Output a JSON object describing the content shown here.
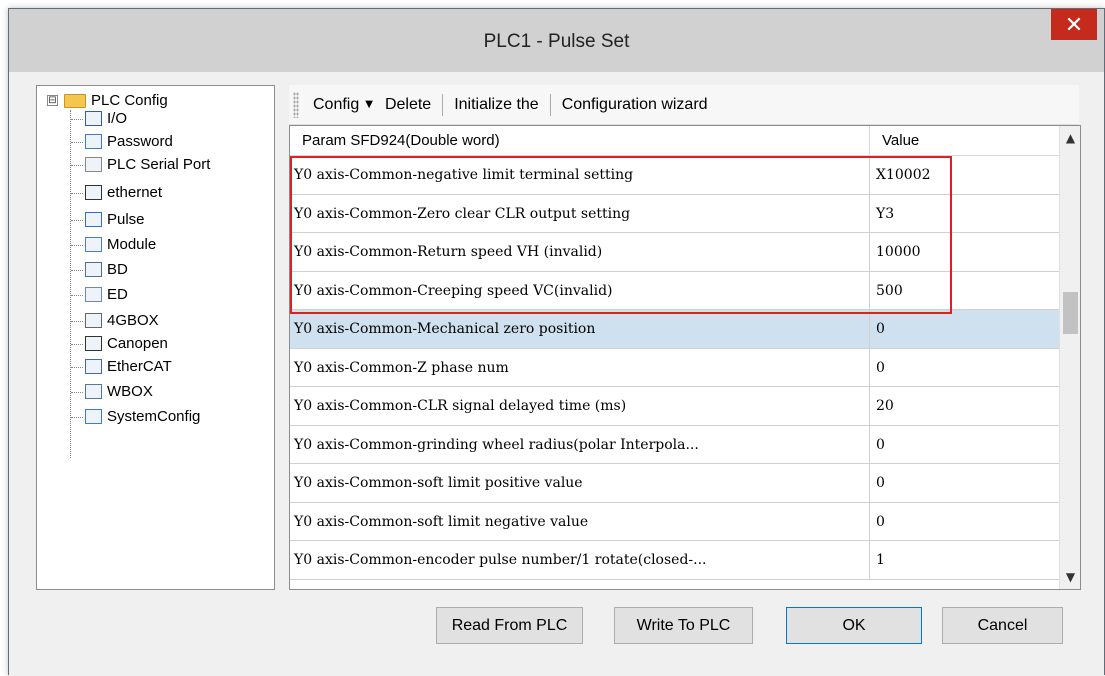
{
  "window": {
    "title": "PLC1 - Pulse  Set",
    "close_glyph": "✕"
  },
  "tree": {
    "root": {
      "label": "PLC Config",
      "expander": "⊟",
      "icon": "folder-icon"
    },
    "items": [
      {
        "label": "I/O",
        "icon": "io-icon"
      },
      {
        "label": "Password",
        "icon": "password-icon"
      },
      {
        "label": "PLC Serial Port",
        "icon": "serial-port-icon"
      },
      {
        "label": "ethernet",
        "icon": "ethernet-icon"
      },
      {
        "label": "Pulse",
        "icon": "pulse-icon"
      },
      {
        "label": "Module",
        "icon": "module-icon"
      },
      {
        "label": "BD",
        "icon": "bd-icon"
      },
      {
        "label": "ED",
        "icon": "ed-icon"
      },
      {
        "label": "4GBOX",
        "icon": "4gbox-icon"
      },
      {
        "label": "Canopen",
        "icon": "canopen-icon"
      },
      {
        "label": "EtherCAT",
        "icon": "ethercat-icon"
      },
      {
        "label": "WBOX",
        "icon": "wbox-icon"
      },
      {
        "label": "SystemConfig",
        "icon": "system-config-icon"
      }
    ]
  },
  "toolbar": {
    "config_label": "Config",
    "config_caret": "▼",
    "delete_label": "Delete",
    "initialize_label": "Initialize the",
    "wizard_label": "Configuration wizard"
  },
  "grid": {
    "header_param": "Param SFD924(Double word)",
    "header_value": "Value",
    "rows": [
      {
        "param": "Y0 axis-Common-negative limit terminal setting",
        "value": "X10002"
      },
      {
        "param": "Y0 axis-Common-Zero clear CLR output setting",
        "value": "Y3"
      },
      {
        "param": "Y0 axis-Common-Return speed VH (invalid)",
        "value": "10000"
      },
      {
        "param": "Y0 axis-Common-Creeping speed VC(invalid)",
        "value": "500"
      },
      {
        "param": "Y0 axis-Common-Mechanical zero position",
        "value": "0"
      },
      {
        "param": "Y0 axis-Common-Z phase num",
        "value": "0"
      },
      {
        "param": "Y0 axis-Common-CLR signal delayed time (ms)",
        "value": "20"
      },
      {
        "param": "Y0 axis-Common-grinding wheel radius(polar Interpola...",
        "value": "0"
      },
      {
        "param": "Y0 axis-Common-soft limit positive value",
        "value": "0"
      },
      {
        "param": "Y0 axis-Common-soft limit negative value",
        "value": "0"
      },
      {
        "param": "Y0 axis-Common-encoder pulse number/1 rotate(closed-...",
        "value": "1"
      }
    ],
    "selected_row_index": 4,
    "highlight_color": "#e02020",
    "scroll_up_glyph": "▲",
    "scroll_down_glyph": "▼"
  },
  "buttons": {
    "read_label": "Read From PLC",
    "write_label": "Write To PLC",
    "ok_label": "OK",
    "cancel_label": "Cancel"
  }
}
